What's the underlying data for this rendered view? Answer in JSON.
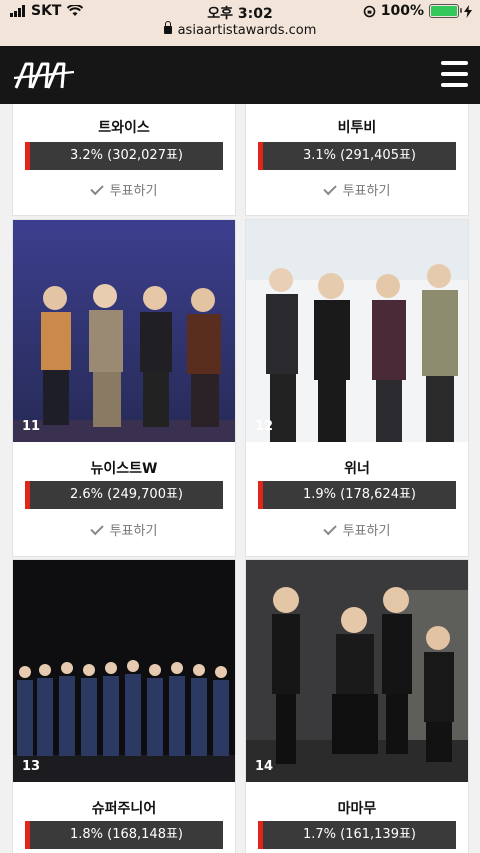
{
  "status_bar": {
    "carrier": "SKT",
    "time": "오후 3:02",
    "battery": "100%",
    "url": "asiaartistawards.com"
  },
  "colors": {
    "accent": "#e0261b",
    "nav_bg": "#161616",
    "bar_bg": "#3a3a3a"
  },
  "vote_label": "투표하기",
  "cards": [
    {
      "name": "트와이스",
      "result": "3.2% (302,027표)"
    },
    {
      "name": "비투비",
      "result": "3.1% (291,405표)"
    },
    {
      "rank": "11",
      "name": "뉴이스트W",
      "result": "2.6% (249,700표)"
    },
    {
      "rank": "12",
      "name": "위너",
      "result": "1.9% (178,624표)"
    },
    {
      "rank": "13",
      "name": "슈퍼주니어",
      "result": "1.8% (168,148표)"
    },
    {
      "rank": "14",
      "name": "마마무",
      "result": "1.7% (161,139표)"
    }
  ]
}
